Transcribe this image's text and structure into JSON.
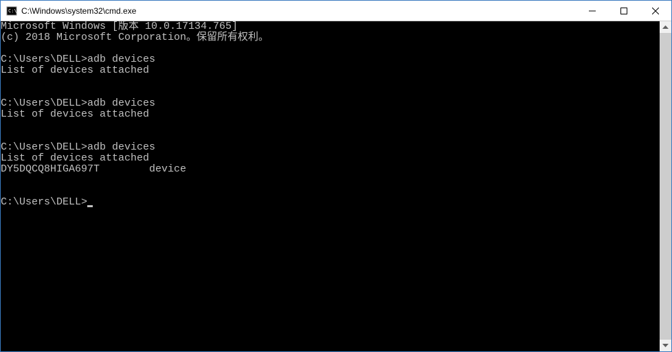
{
  "titlebar": {
    "title": "C:\\Windows\\system32\\cmd.exe"
  },
  "terminal": {
    "header1": "Microsoft Windows [版本 10.0.17134.765]",
    "header2": "(c) 2018 Microsoft Corporation。保留所有权利。",
    "blocks": [
      {
        "prompt": "C:\\Users\\DELL>",
        "command": "adb devices",
        "output": [
          "List of devices attached"
        ]
      },
      {
        "prompt": "C:\\Users\\DELL>",
        "command": "adb devices",
        "output": [
          "List of devices attached"
        ]
      },
      {
        "prompt": "C:\\Users\\DELL>",
        "command": "adb devices",
        "output": [
          "List of devices attached",
          "DY5DQCQ8HIGA697T        device"
        ]
      }
    ],
    "final_prompt": "C:\\Users\\DELL>"
  }
}
